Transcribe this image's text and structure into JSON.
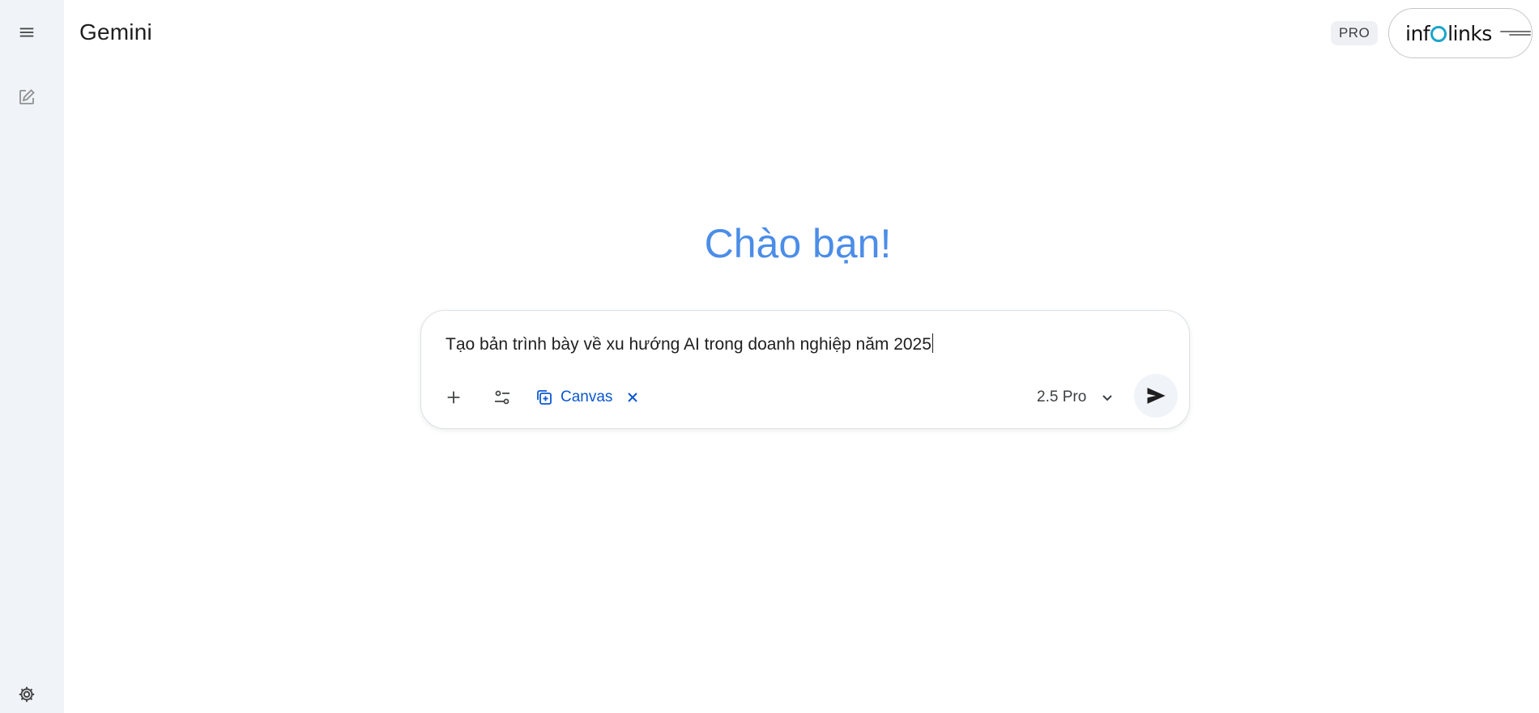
{
  "app": {
    "title": "Gemini",
    "plan_badge": "PRO"
  },
  "account": {
    "brand_text_left": "inf",
    "brand_text_right": "links"
  },
  "greeting": "Chào bạn!",
  "composer": {
    "prompt_value": "Tạo bản trình bày về xu hướng AI trong doanh nghiệp năm 2025",
    "tool_chip_label": "Canvas",
    "model_label": "2.5 Pro"
  },
  "icons": {
    "menu": "menu-icon",
    "new_chat": "edit-icon",
    "settings": "gear-icon",
    "add": "plus-icon",
    "tools": "tune-icon",
    "canvas": "canvas-icon",
    "close": "close-icon",
    "dropdown": "chevron-down-icon",
    "send": "send-icon"
  },
  "colors": {
    "rail_background": "#f0f4f9",
    "greeting": "#4b8de8",
    "accent": "#0b57d0",
    "brand_swirl": "#1aa6c9"
  }
}
